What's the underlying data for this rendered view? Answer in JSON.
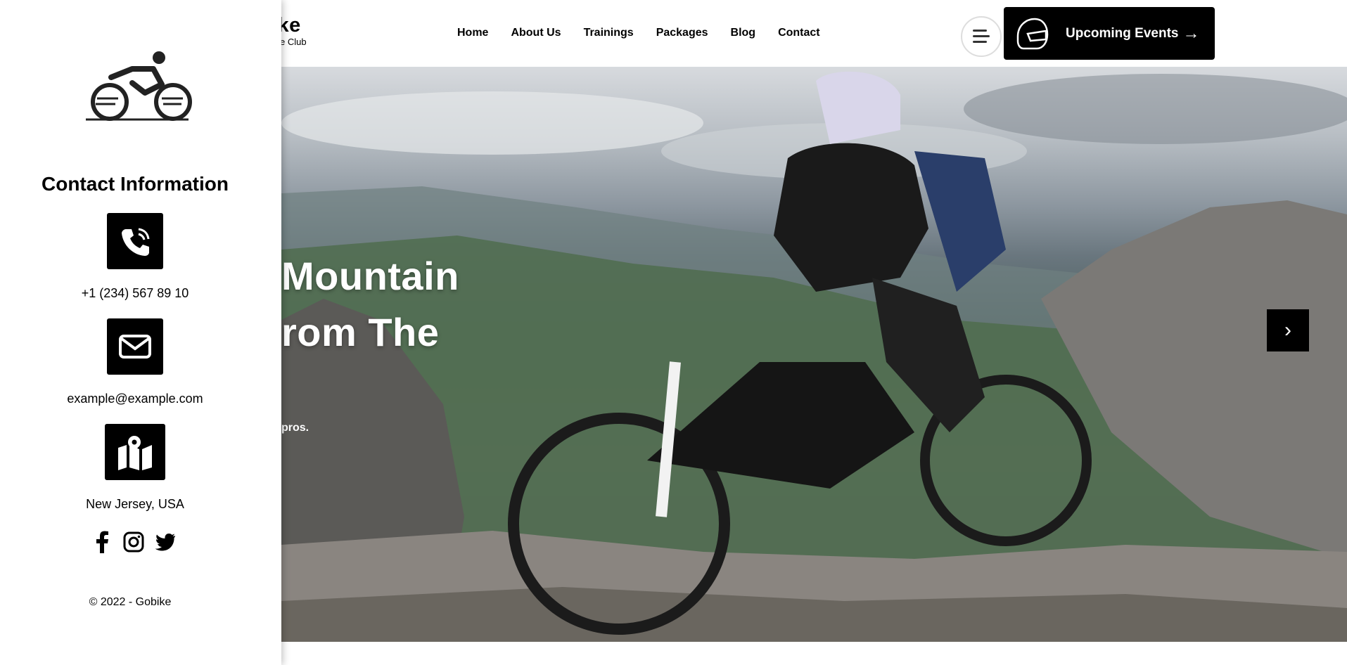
{
  "header": {
    "logo_text": "ike",
    "logo_sub": "e Club",
    "nav": [
      "Home",
      "About Us",
      "Trainings",
      "Packages",
      "Blog",
      "Contact"
    ],
    "events_label": "Upcoming Events",
    "events_arrow": "→"
  },
  "hero": {
    "title_line1": "Mountain",
    "title_line2": "rom The",
    "subtitle": "pros.",
    "next_glyph": "›"
  },
  "sidebar": {
    "title": "Contact Information",
    "phone": "+1 (234) 567 89 10",
    "email": "example@example.com",
    "location": "New Jersey, USA",
    "copyright": "© 2022 - Gobike"
  },
  "colors": {
    "accent": "#000000",
    "background": "#ffffff"
  },
  "icons": [
    "bike-logo-icon",
    "phone-icon",
    "mail-icon",
    "map-icon",
    "facebook-icon",
    "instagram-icon",
    "twitter-icon",
    "helmet-icon",
    "menu-icon",
    "chevron-right-icon"
  ]
}
